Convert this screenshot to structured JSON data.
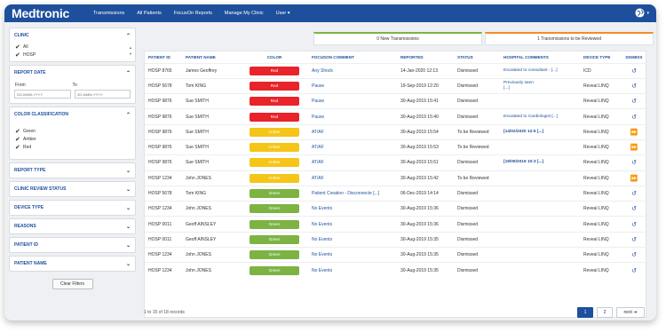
{
  "app": {
    "logo": "Medtronic",
    "nav": [
      "Transmissions",
      "All Patients",
      "FocusOn Reports",
      "Manage My Clinic",
      "User"
    ],
    "user_caret": "▾"
  },
  "sidebar": {
    "clinic": {
      "title": "CLINIC",
      "options": [
        "All",
        "HOSP"
      ]
    },
    "report_date": {
      "title": "REPORT DATE",
      "from_label": "From",
      "to_label": "To",
      "from_placeholder": "DD-MMM-YYYY",
      "to_placeholder": "DD-MMM-YYYY"
    },
    "color_classification": {
      "title": "COLOR CLASSIFICATION",
      "options": [
        "Green",
        "Amber",
        "Red"
      ]
    },
    "collapsed_sections": [
      "REPORT TYPE",
      "CLINIC REVIEW STATUS",
      "DEVICE TYPE",
      "REASONS",
      "PATIENT ID",
      "PATIENT NAME"
    ],
    "clear_filters": "Clear Filters"
  },
  "tabs": {
    "new_transmissions": "0 New Transmissions",
    "to_be_reviewed": "1 Transmissions to be Reviewed"
  },
  "table": {
    "headers": [
      "PATIENT ID",
      "PATIENT NAME",
      "COLOR",
      "FOCUSON COMMENT",
      "REPORTED",
      "STATUS",
      "HOSPITAL COMMENTS",
      "DEVICE TYPE",
      "DISMISS"
    ],
    "rows": [
      {
        "id": "HOSP 8765",
        "name": "James Geoffrey",
        "color": "Red",
        "comment": "Any Shock",
        "reported": "14-Jan-2020 12:13",
        "status": "Dismissed",
        "hospital": "Escalated to consultant - [...]",
        "device": "ICD",
        "dismiss": "↺"
      },
      {
        "id": "HOSP 5678",
        "name": "Tom KING",
        "color": "Red",
        "comment": "Pause",
        "reported": "19-Sep-2019 12:20",
        "status": "Dismissed",
        "hospital": "Previously seen\n[...]",
        "device": "Reveal LINQ",
        "dismiss": "↺"
      },
      {
        "id": "HOSP 9876",
        "name": "Sue SMITH",
        "color": "Red",
        "comment": "Pause",
        "reported": "30-Aug-2019 15:41",
        "status": "Dismissed",
        "hospital": "",
        "device": "Reveal LINQ",
        "dismiss": "↺"
      },
      {
        "id": "HOSP 9876",
        "name": "Sue SMITH",
        "color": "Red",
        "comment": "Pause",
        "reported": "30-Aug-2019 15:40",
        "status": "Dismissed",
        "hospital": "Escalated to Cardiologist [...]",
        "device": "Reveal LINQ",
        "dismiss": "↺"
      },
      {
        "id": "HOSP 9876",
        "name": "Sue SMITH",
        "color": "Amber",
        "comment": "AT/AF",
        "reported": "30-Aug-2019 15:54",
        "status": "To be Reviewed",
        "hospital": "[14/02/2020 12:5 [...]",
        "device": "Reveal LINQ",
        "dismiss": "⏩"
      },
      {
        "id": "HOSP 9876",
        "name": "Sue SMITH",
        "color": "Amber",
        "comment": "AT/AF",
        "reported": "30-Aug-2019 15:53",
        "status": "To be Reviewed",
        "hospital": "",
        "device": "Reveal LINQ",
        "dismiss": "⏩"
      },
      {
        "id": "HOSP 9876",
        "name": "Sue SMITH",
        "color": "Amber",
        "comment": "AT/AF",
        "reported": "30-Aug-2019 15:51",
        "status": "Dismissed",
        "hospital": "[19/09/2019 10:3 [...]",
        "device": "Reveal LINQ",
        "dismiss": "↺"
      },
      {
        "id": "HOSP 1234",
        "name": "John JONES",
        "color": "Amber",
        "comment": "AT/AF",
        "reported": "30-Aug-2019 15:42",
        "status": "To be Reviewed",
        "hospital": "",
        "device": "Reveal LINQ",
        "dismiss": "⏩"
      },
      {
        "id": "HOSP 5678",
        "name": "Tom KING",
        "color": "Green",
        "comment": "Patient Creation - Disconnecte [...]",
        "reported": "06-Dec-2019 14:14",
        "status": "Dismissed",
        "hospital": "",
        "device": "Reveal LINQ",
        "dismiss": "↺"
      },
      {
        "id": "HOSP 1234",
        "name": "John JONES",
        "color": "Green",
        "comment": "No Events",
        "reported": "30-Aug-2019 15:36",
        "status": "Dismissed",
        "hospital": "",
        "device": "Reveal LINQ",
        "dismiss": "↺"
      },
      {
        "id": "HOSP 0011",
        "name": "Geoff AINSLEY",
        "color": "Green",
        "comment": "No Events",
        "reported": "30-Aug-2019 15:36",
        "status": "Dismissed",
        "hospital": "",
        "device": "Reveal LINQ",
        "dismiss": "↺"
      },
      {
        "id": "HOSP 0011",
        "name": "Geoff AINSLEY",
        "color": "Green",
        "comment": "No Events",
        "reported": "30-Aug-2019 15:35",
        "status": "Dismissed",
        "hospital": "",
        "device": "Reveal LINQ",
        "dismiss": "↺"
      },
      {
        "id": "HOSP 1234",
        "name": "John JONES",
        "color": "Green",
        "comment": "No Events",
        "reported": "30-Aug-2019 15:35",
        "status": "Dismissed",
        "hospital": "",
        "device": "Reveal LINQ",
        "dismiss": "↺"
      },
      {
        "id": "HOSP 1234",
        "name": "John JONES",
        "color": "Green",
        "comment": "No Events",
        "reported": "30-Aug-2019 15:35",
        "status": "Dismissed",
        "hospital": "",
        "device": "Reveal LINQ",
        "dismiss": "↺"
      }
    ]
  },
  "footer": {
    "records": "1 to 15 of 18 records",
    "pages": [
      "1",
      "2"
    ],
    "next": "next ➜"
  },
  "colors": {
    "brand": "#1e4f9c",
    "Red": "#e8232a",
    "Amber": "#f5c518",
    "Green": "#7cb342"
  }
}
